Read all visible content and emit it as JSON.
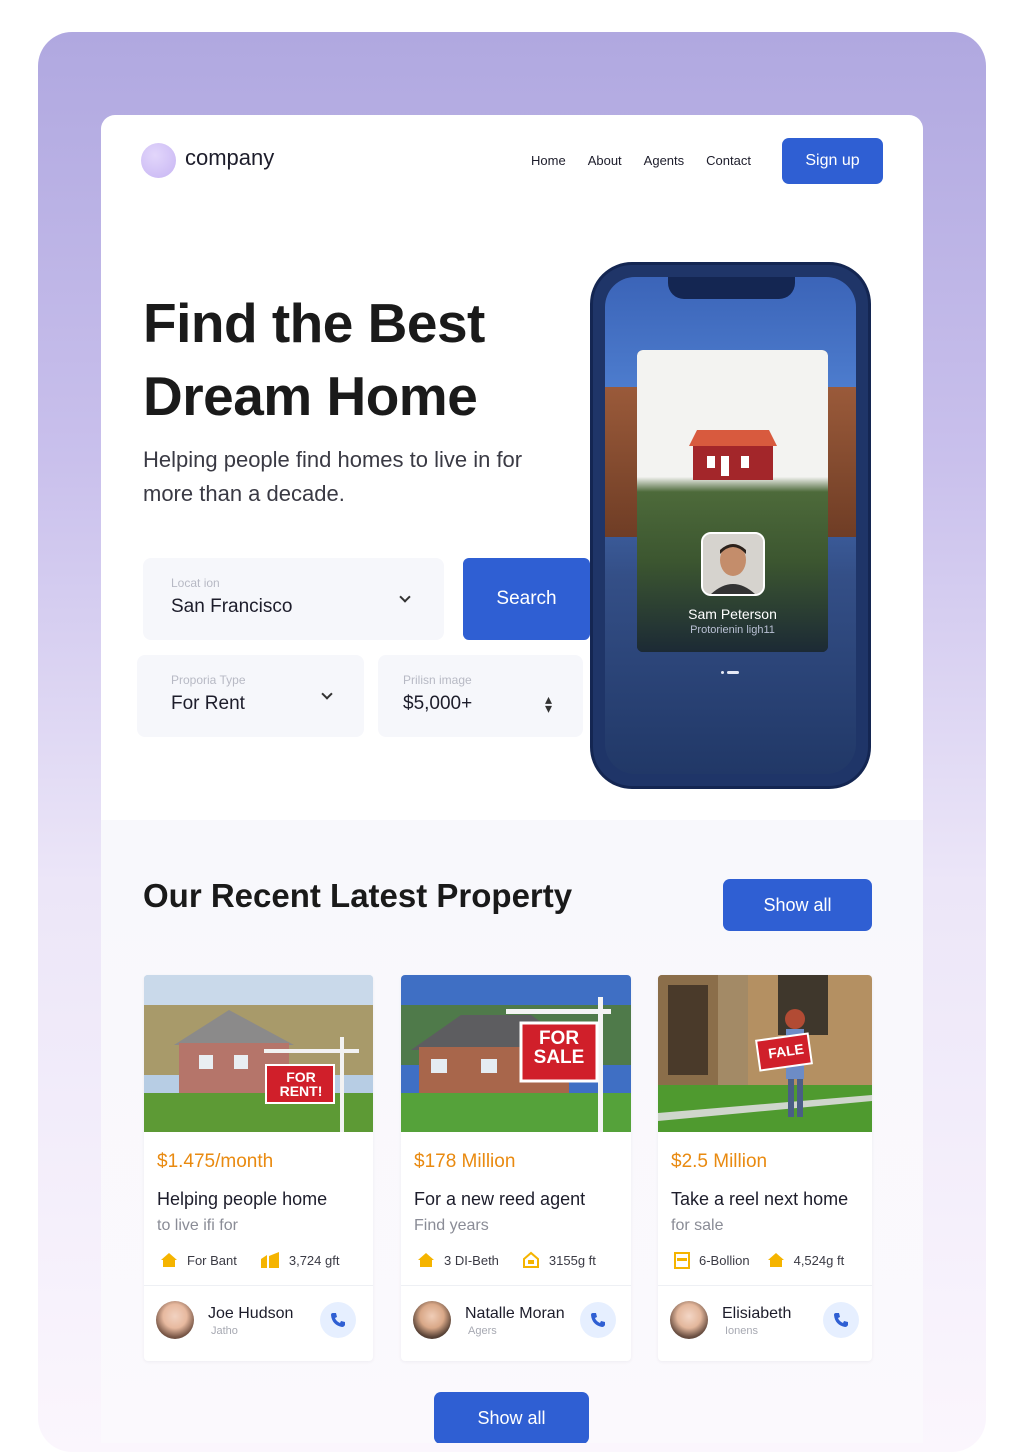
{
  "brand": {
    "name": "company"
  },
  "nav": {
    "items": [
      {
        "label": "Home"
      },
      {
        "label": "About"
      },
      {
        "label": "Agents"
      },
      {
        "label": "Contact"
      }
    ],
    "signup_label": "Sign up"
  },
  "hero": {
    "title_line1": "Find the Best",
    "title_line2": "Dream Home",
    "subtitle": "Helping people find homes to live in for more than a decade."
  },
  "search": {
    "location": {
      "label": "Locat ion",
      "value": "San Francisco"
    },
    "property_type": {
      "label": "Proporia Type",
      "value": "For Rent"
    },
    "price": {
      "label": "Prilisn image",
      "value": "$5,000+"
    },
    "button_label": "Search"
  },
  "phone_profile": {
    "name": "Sam Peterson",
    "role": "Protorienin ligh11"
  },
  "recent": {
    "title": "Our Recent Latest Property",
    "show_all_label": "Show all",
    "properties": [
      {
        "sign_text": "FOR RENT!",
        "price": "$1.475/month",
        "title": "Helping people home",
        "subtitle": "to live ifi for",
        "meta1": "For Bant",
        "meta2": "3,724 gft",
        "agent_name": "Joe Hudson",
        "agent_role": "Jatho"
      },
      {
        "sign_text": "FOR SALE",
        "price": "$178  Million",
        "title": "For a new reed agent",
        "subtitle": "Find years",
        "meta1": "3 DI-Beth",
        "meta2": "3155g ft",
        "agent_name": "Natalle Moran",
        "agent_role": "Agers"
      },
      {
        "sign_text": "FALE",
        "price": "$2.5 Million",
        "title": "Take a reel next home",
        "subtitle": "for sale",
        "meta1": "6-Bollion",
        "meta2": "4,524g ft",
        "agent_name": "Elisiabeth",
        "agent_role": "Ionens"
      }
    ],
    "bottom_show_all_label": "Show all"
  },
  "colors": {
    "accent": "#2f5fd3",
    "price": "#e98a10",
    "backdrop": "#b0a8e0",
    "phone": "#1f3568",
    "icon_yellow": "#f5b400"
  }
}
